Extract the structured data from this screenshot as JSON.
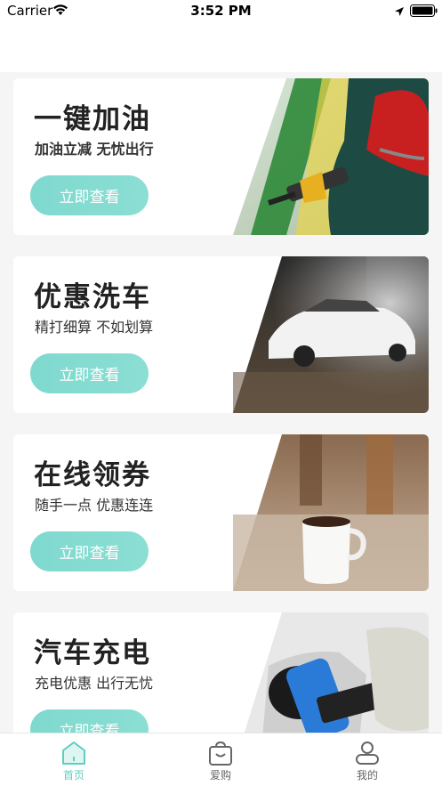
{
  "status_bar": {
    "carrier": "Carrier",
    "time": "3:52 PM"
  },
  "cards": [
    {
      "title": "一键加油",
      "subtitle": "加油立减 无忧出行",
      "button": "立即查看",
      "image": "fuel-pump-photo"
    },
    {
      "title": "优惠洗车",
      "subtitle": "精打细算 不如划算",
      "button": "立即查看",
      "image": "car-wash-photo"
    },
    {
      "title": "在线领券",
      "subtitle": "随手一点 优惠连连",
      "button": "立即查看",
      "image": "coffee-cup-photo"
    },
    {
      "title": "汽车充电",
      "subtitle": "充电优惠 出行无忧",
      "button": "立即查看",
      "image": "ev-charging-photo"
    }
  ],
  "tab_bar": {
    "items": [
      {
        "label": "首页",
        "icon": "home-icon",
        "active": true
      },
      {
        "label": "爱购",
        "icon": "shopping-bag-icon",
        "active": false
      },
      {
        "label": "我的",
        "icon": "profile-icon",
        "active": false
      }
    ]
  },
  "colors": {
    "accent": "#5ccfc2",
    "button": "#7fd9cf"
  }
}
